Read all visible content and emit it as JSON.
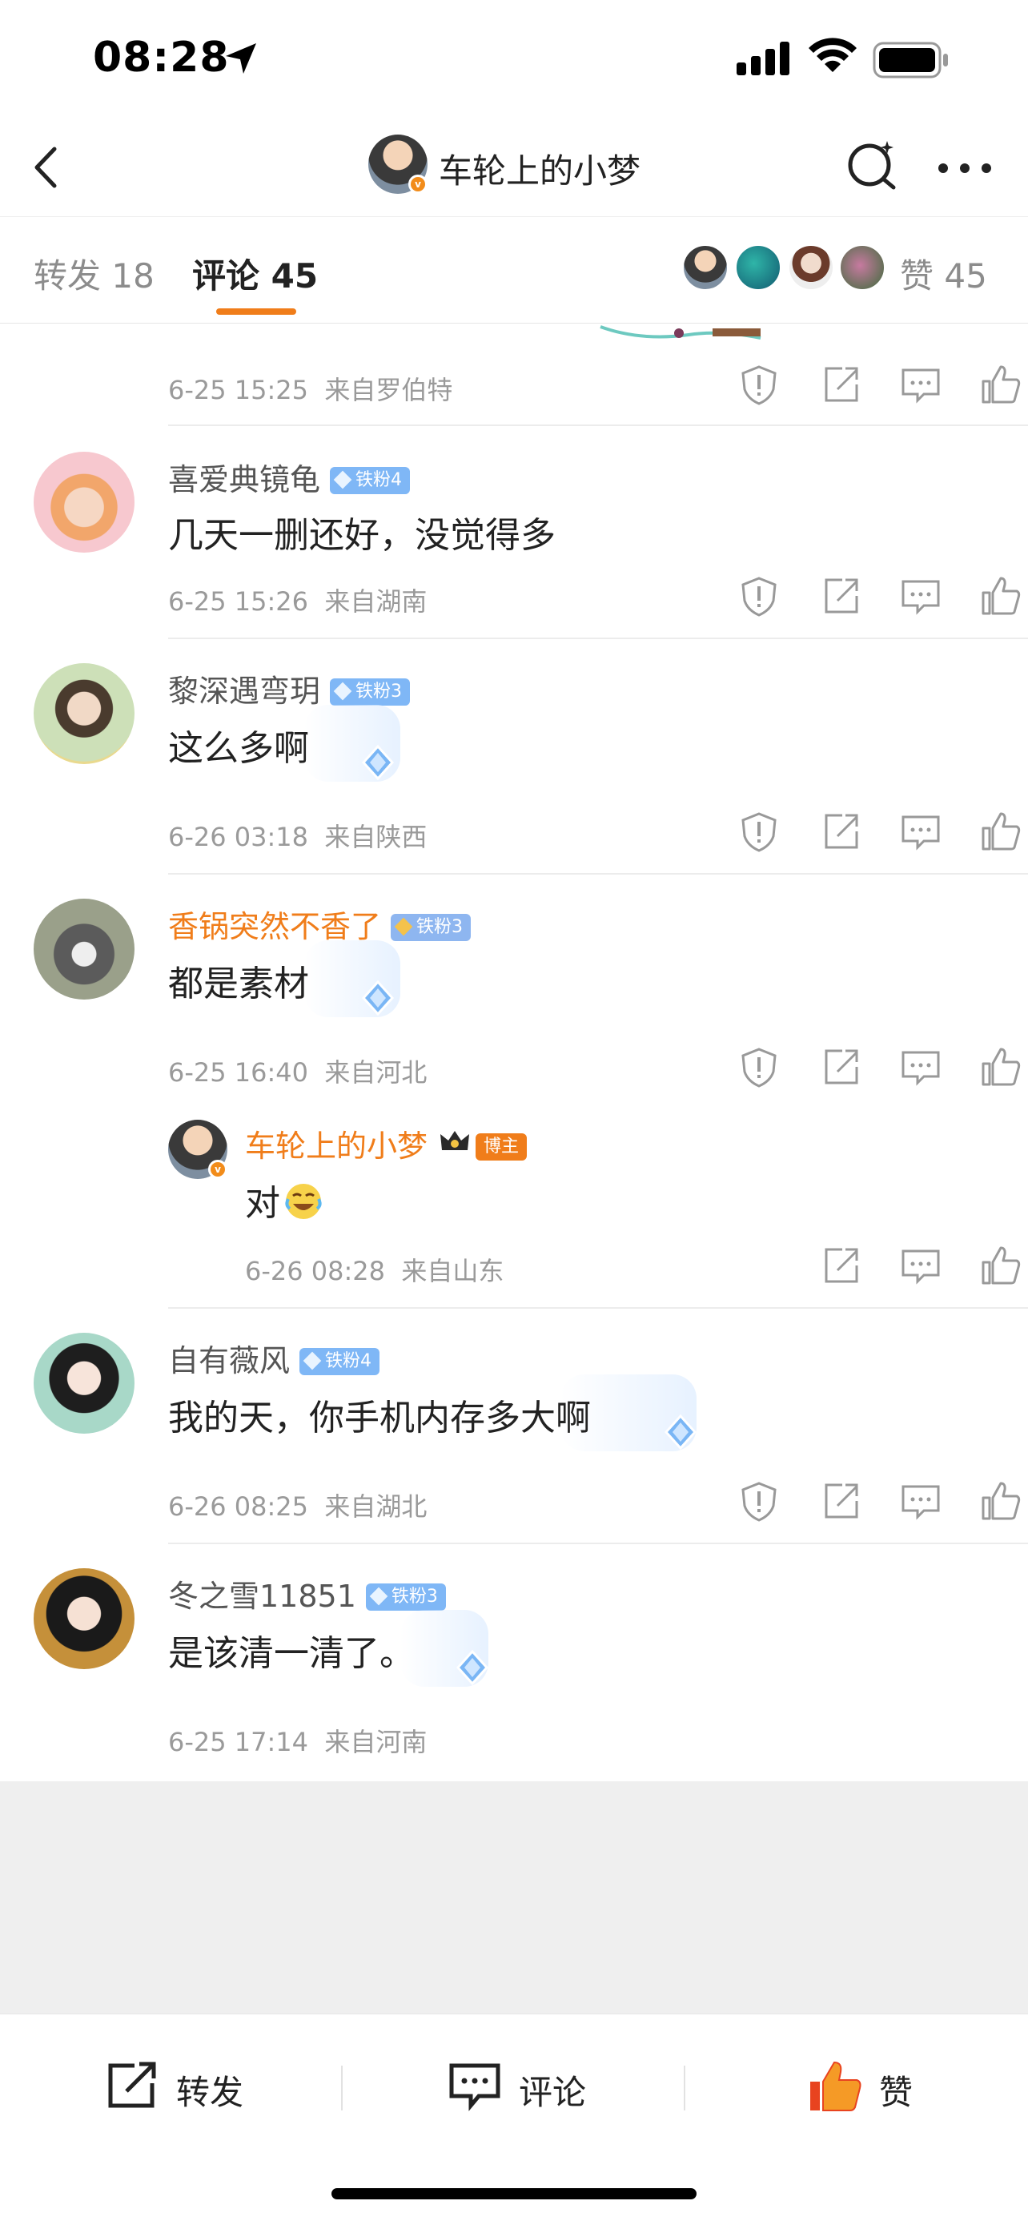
{
  "status_bar": {
    "time": "08:28"
  },
  "nav": {
    "title": "车轮上的小梦"
  },
  "tabs": {
    "repost": "转发 18",
    "comment": "评论 45",
    "likes": "赞 45"
  },
  "colors": {
    "accent": "#f07d1a",
    "fan_badge": "#7fb7f6",
    "meta": "#9a9a9a"
  },
  "comments": [
    {
      "meta_date": "6-25 15:25",
      "meta_source": "来自罗伯特"
    },
    {
      "user": "喜爱典镜龟",
      "fan_badge": "铁粉4",
      "text": "几天一删还好，没觉得多",
      "meta_date": "6-25 15:26",
      "meta_source": "来自湖南"
    },
    {
      "user": "黎深遇弯玥",
      "fan_badge": "铁粉3",
      "text": "这么多啊",
      "meta_date": "6-26 03:18",
      "meta_source": "来自陕西"
    },
    {
      "user": "香锅突然不香了",
      "fan_badge": "铁粉3",
      "text": "都是素材",
      "meta_date": "6-25 16:40",
      "meta_source": "来自河北",
      "reply": {
        "user": "车轮上的小梦",
        "host_badge": "博主",
        "text": "对",
        "meta_date": "6-26 08:28",
        "meta_source": "来自山东"
      }
    },
    {
      "user": "自有薇风",
      "fan_badge": "铁粉4",
      "text": "我的天，你手机内存多大啊",
      "meta_date": "6-26 08:25",
      "meta_source": "来自湖北"
    },
    {
      "user": "冬之雪11851",
      "fan_badge": "铁粉3",
      "text": "是该清一清了。",
      "meta_date": "6-25 17:14",
      "meta_source": "来自河南"
    }
  ],
  "bottom_bar": {
    "repost": "转发",
    "comment": "评论",
    "like": "赞"
  }
}
